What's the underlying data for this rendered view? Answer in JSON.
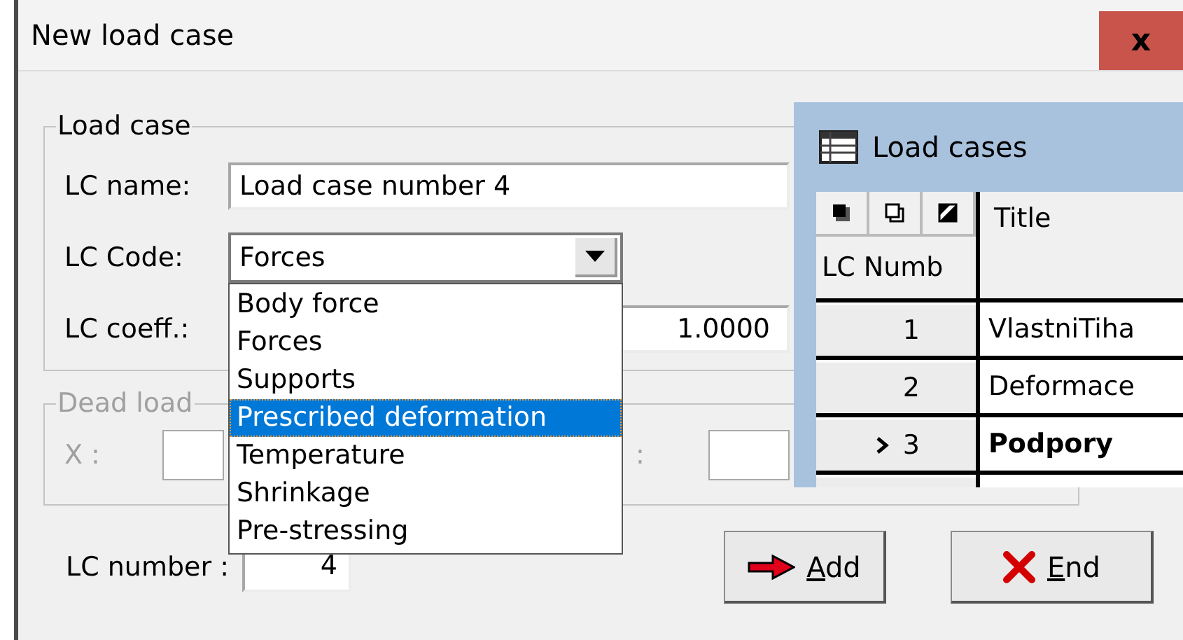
{
  "window": {
    "title": "New load case",
    "close_label": "x"
  },
  "load_case_group": {
    "title": "Load case",
    "fields": [
      {
        "label": "LC name:",
        "kind": "text",
        "value": "Load case number 4"
      },
      {
        "label": "LC Code:",
        "kind": "combo",
        "value": "Forces"
      },
      {
        "label": "LC coeff.:",
        "kind": "number",
        "value": "1.0000"
      }
    ]
  },
  "code_dropdown": {
    "options": [
      {
        "label": "Body force",
        "selected": false
      },
      {
        "label": "Forces",
        "selected": false
      },
      {
        "label": "Supports",
        "selected": false
      },
      {
        "label": "Prescribed deformation",
        "selected": true
      },
      {
        "label": "Temperature",
        "selected": false
      },
      {
        "label": "Shrinkage",
        "selected": false
      },
      {
        "label": "Pre-stressing",
        "selected": false
      }
    ]
  },
  "dead_load_group": {
    "title": "Dead load",
    "disabled": true,
    "fields": [
      {
        "label": "X :"
      },
      {
        "label": ":"
      }
    ]
  },
  "lc_number": {
    "label": "LC number :",
    "value": "4"
  },
  "buttons": [
    {
      "label": "Add",
      "kind": "add",
      "underline_first": true
    },
    {
      "label": "End",
      "kind": "end",
      "underline_first": true
    }
  ],
  "load_cases_window": {
    "title": "Load cases",
    "columns": [
      "LC Numb",
      "Title"
    ],
    "rows": [
      {
        "number": "1",
        "title": "VlastniTiha",
        "current": false
      },
      {
        "number": "2",
        "title": "Deformace",
        "current": false
      },
      {
        "number": "3",
        "title": "Podpory",
        "current": true
      }
    ]
  }
}
